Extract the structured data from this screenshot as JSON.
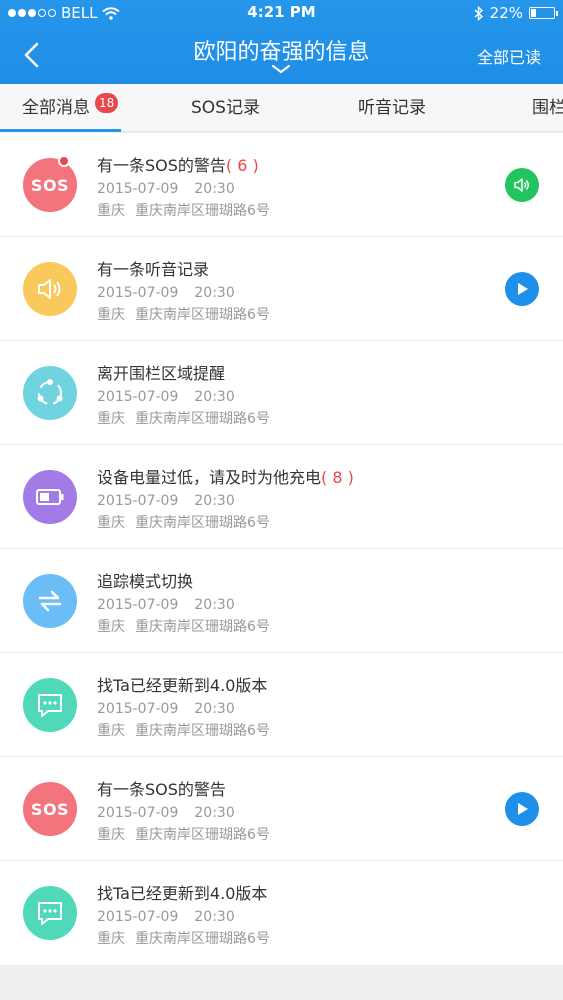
{
  "status_bar": {
    "carrier": "BELL",
    "time": "4:21 PM",
    "battery": "22%",
    "battery_level": 0.22
  },
  "nav": {
    "title": "欧阳的奋强的信息",
    "mark_all_read": "全部已读"
  },
  "tabs": [
    {
      "label": "全部消息",
      "badge": "18",
      "active": true
    },
    {
      "label": "SOS记录"
    },
    {
      "label": "听音记录"
    },
    {
      "label": "围栏"
    }
  ],
  "colors": {
    "header_blue": "#2596ea",
    "sos_red": "#f3747c",
    "audio_yellow": "#f9c95b",
    "fence_cyan": "#6fd4e0",
    "battery_purple": "#a37be6",
    "track_blue": "#6bbdf5",
    "update_teal": "#4fd8b9",
    "action_green": "#21c45e",
    "action_blue": "#1e90ea",
    "badge_red": "#e9474c"
  },
  "messages": [
    {
      "icon": "sos-icon",
      "icon_text": "SOS",
      "title": "有一条SOS的警告",
      "count": "( 6 )",
      "date": "2015-07-09",
      "time": "20:30",
      "city": "重庆",
      "address": "重庆南岸区珊瑚路6号",
      "unread": true,
      "action": "speaker-icon"
    },
    {
      "icon": "speaker-icon",
      "title": "有一条听音记录",
      "date": "2015-07-09",
      "time": "20:30",
      "city": "重庆",
      "address": "重庆南岸区珊瑚路6号",
      "action": "play-icon"
    },
    {
      "icon": "fence-icon",
      "title": "离开围栏区域提醒",
      "date": "2015-07-09",
      "time": "20:30",
      "city": "重庆",
      "address": "重庆南岸区珊瑚路6号"
    },
    {
      "icon": "battery-low-icon",
      "title": "设备电量过低，请及时为他充电",
      "count": "( 8 )",
      "date": "2015-07-09",
      "time": "20:30",
      "city": "重庆",
      "address": "重庆南岸区珊瑚路6号"
    },
    {
      "icon": "swap-icon",
      "title": "追踪模式切换",
      "date": "2015-07-09",
      "time": "20:30",
      "city": "重庆",
      "address": "重庆南岸区珊瑚路6号"
    },
    {
      "icon": "chat-icon",
      "title": "找Ta已经更新到4.0版本",
      "date": "2015-07-09",
      "time": "20:30",
      "city": "重庆",
      "address": "重庆南岸区珊瑚路6号"
    },
    {
      "icon": "sos-icon",
      "icon_text": "SOS",
      "title": "有一条SOS的警告",
      "date": "2015-07-09",
      "time": "20:30",
      "city": "重庆",
      "address": "重庆南岸区珊瑚路6号",
      "action": "play-icon"
    },
    {
      "icon": "chat-icon",
      "title": "找Ta已经更新到4.0版本",
      "date": "2015-07-09",
      "time": "20:30",
      "city": "重庆",
      "address": "重庆南岸区珊瑚路6号"
    }
  ]
}
